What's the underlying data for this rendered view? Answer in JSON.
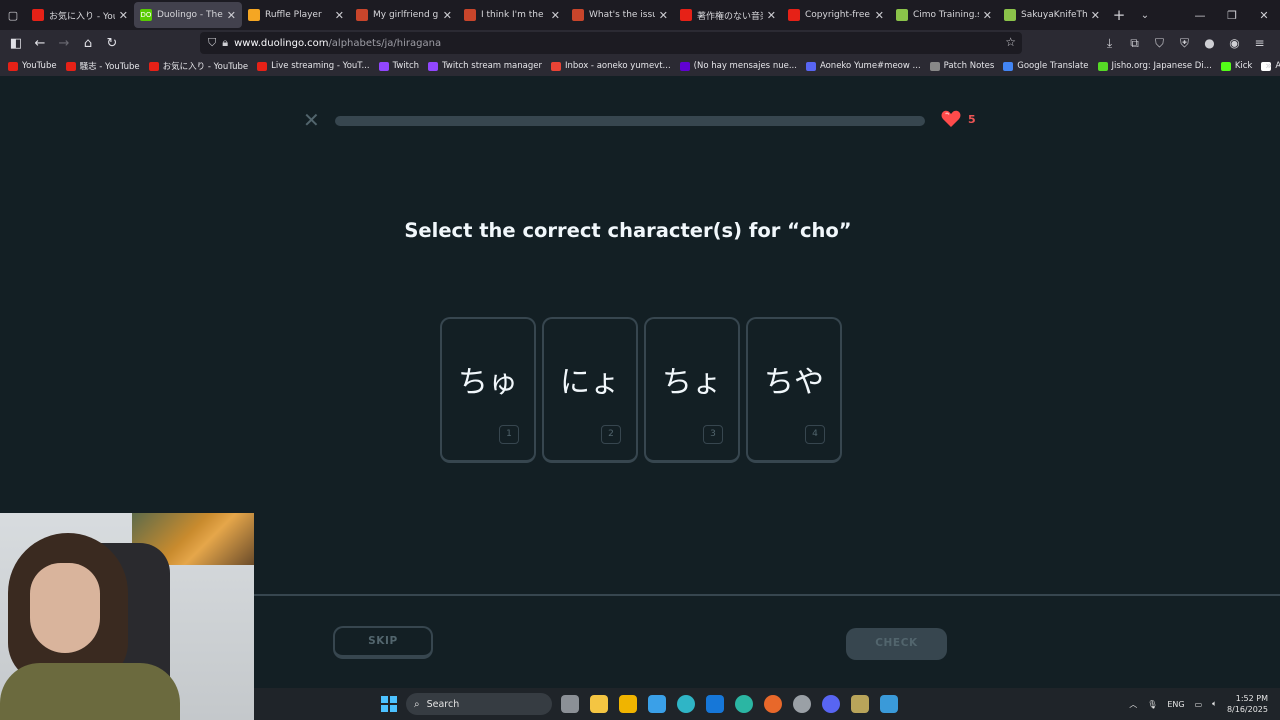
{
  "browser": {
    "tabs": [
      {
        "title": "お気に入り - YouTube",
        "favicon_color": "#e62117",
        "active": false
      },
      {
        "title": "Duolingo - The world",
        "favicon_color": "#58cc02",
        "active": true,
        "favicon_text": "DO"
      },
      {
        "title": "Ruffle Player",
        "favicon_color": "#f5a623",
        "active": false
      },
      {
        "title": "My girlfriend ghost",
        "favicon_color": "#c8452b",
        "active": false
      },
      {
        "title": "I think I'm the last p",
        "favicon_color": "#c8452b",
        "active": false
      },
      {
        "title": "What's the issue wit",
        "favicon_color": "#c8452b",
        "active": false
      },
      {
        "title": "著作権のない音楽 -",
        "favicon_color": "#e62117",
        "active": false
      },
      {
        "title": "Copyright-free",
        "favicon_color": "#e62117",
        "active": false
      },
      {
        "title": "Cimo Training.swf (",
        "favicon_color": "#8bc34a",
        "active": false
      },
      {
        "title": "SakuyaKnifeThrowe",
        "favicon_color": "#8bc34a",
        "active": false
      }
    ],
    "url": {
      "host": "www.duolingo.com",
      "path": "/alphabets/ja/hiragana"
    },
    "bookmarks": [
      {
        "label": "YouTube",
        "color": "#e62117"
      },
      {
        "label": "騒志 - YouTube",
        "color": "#e62117"
      },
      {
        "label": "お気に入り - YouTube",
        "color": "#e62117"
      },
      {
        "label": "Live streaming - YouT...",
        "color": "#e62117"
      },
      {
        "label": "Twitch",
        "color": "#9146ff"
      },
      {
        "label": "Twitch stream manager",
        "color": "#9146ff"
      },
      {
        "label": "Inbox - aoneko yumevt...",
        "color": "#ea4335"
      },
      {
        "label": "(No hay mensajes nue...",
        "color": "#6001d2"
      },
      {
        "label": "Aoneko Yume#meow ...",
        "color": "#5865f2"
      },
      {
        "label": "Patch Notes",
        "color": "#888888"
      },
      {
        "label": "Google Translate",
        "color": "#4285f4"
      },
      {
        "label": "Jisho.org: Japanese Di...",
        "color": "#56d926"
      },
      {
        "label": "Kick",
        "color": "#53fc18"
      },
      {
        "label": "Aoneko Yume (@aone...",
        "color": "#ffffff"
      }
    ]
  },
  "lesson": {
    "progress_fraction": 0.0,
    "hearts": "5",
    "prompt": "Select the correct character(s) for “cho”",
    "choices": [
      {
        "text": "ちゅ",
        "key": "1"
      },
      {
        "text": "にょ",
        "key": "2"
      },
      {
        "text": "ちょ",
        "key": "3"
      },
      {
        "text": "ちや",
        "key": "4"
      }
    ],
    "skip_label": "SKIP",
    "check_label": "CHECK"
  },
  "taskbar": {
    "search_label": "Search",
    "language": "ENG",
    "time": "1:52 PM",
    "date": "8/16/2025"
  }
}
